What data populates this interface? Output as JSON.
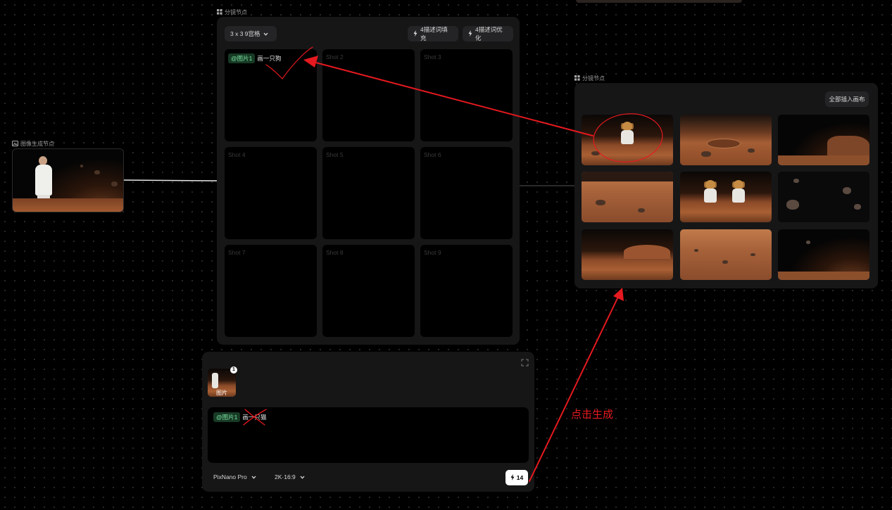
{
  "image_node": {
    "label": "图像生成节点"
  },
  "storyboard_node": {
    "label": "分镜节点",
    "grid_select": "3 x 3 9宫格",
    "fill_btn": "4描述词填充",
    "optimize_btn": "4描述词优化",
    "shot1_tag": "@图片1",
    "shot1_text": "画一只狗",
    "shots": [
      "Shot 2",
      "Shot 3",
      "Shot 4",
      "Shot 5",
      "Shot 6",
      "Shot 7",
      "Shot 8",
      "Shot 9"
    ]
  },
  "result_node": {
    "label": "分镜节点",
    "insert_all_btn": "全部插入画布"
  },
  "prompt_panel": {
    "ref_badge": "1",
    "ref_label": "图片",
    "prompt_tag": "@图片1",
    "prompt_text": "画一只猫",
    "model_select": "PixNano Pro",
    "ratio_select": "2K·16:9",
    "generate_cost": "14"
  },
  "annotation": {
    "text": "点击生成"
  },
  "colors": {
    "accent_red": "#e5191f",
    "tag_green": "#7de3a3",
    "panel_bg": "#161617"
  }
}
